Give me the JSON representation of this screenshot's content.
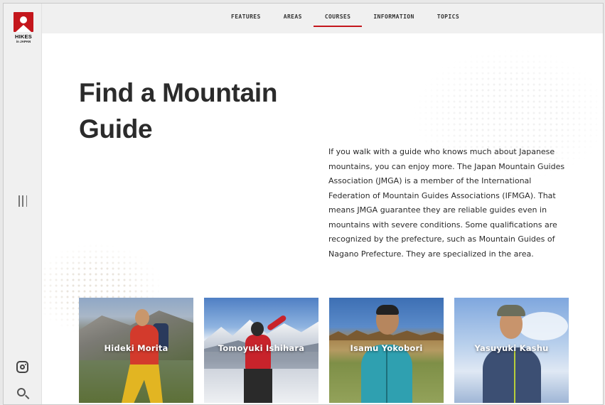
{
  "brand": {
    "name": "HIKES",
    "sub": "in JAPAN",
    "accent": "#c4161c"
  },
  "nav": {
    "items": [
      {
        "label": "FEATURES",
        "active": false
      },
      {
        "label": "AREAS",
        "active": false
      },
      {
        "label": "COURSES",
        "active": true
      },
      {
        "label": "INFORMATION",
        "active": false
      },
      {
        "label": "TOPICS",
        "active": false
      }
    ]
  },
  "sidebar": {
    "icons": [
      "menu-icon",
      "instagram-icon",
      "search-icon"
    ]
  },
  "page": {
    "title": "Find a Mountain Guide",
    "intro": "If you walk with a guide who knows much about Japanese mountains, you can enjoy more. The Japan Mountain Guides Association (JMGA) is a member of the International Federation of Mountain Guides Associations (IFMGA). That means JMGA guarantee they are reliable guides even in mountains with severe conditions. Some qualifications are recognized by the prefecture, such as Mountain Guides of Nagano Prefecture. They are specialized in the area."
  },
  "guides": [
    {
      "name": "Hideki Morita"
    },
    {
      "name": "Tomoyuki Ishihara"
    },
    {
      "name": "Isamu Yokobori"
    },
    {
      "name": "Yasuyuki Kashu"
    }
  ]
}
